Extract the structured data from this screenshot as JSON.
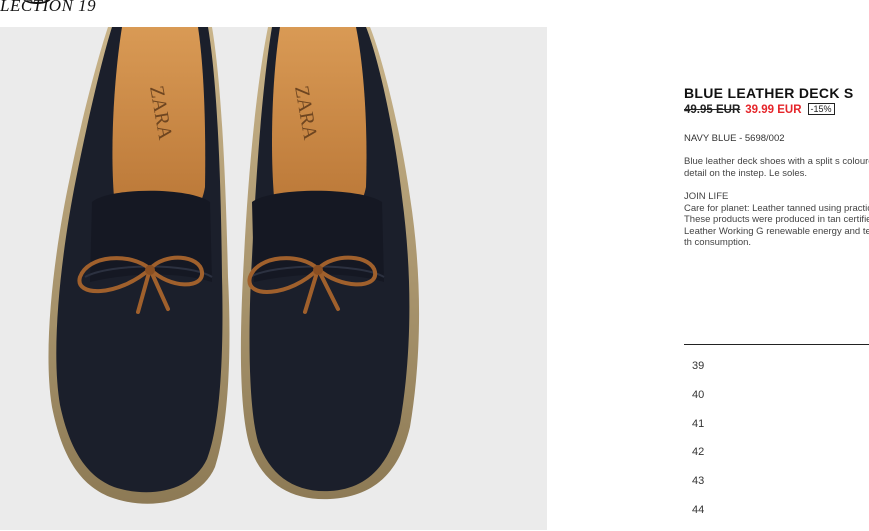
{
  "header": {
    "collection_label": "LECTION 19"
  },
  "product": {
    "title": "BLUE LEATHER DECK S",
    "price_old": "49.95 EUR",
    "price_new": "39.99 EUR",
    "discount": "-15%",
    "color_ref": "NAVY BLUE - 5698/002",
    "description": "Blue leather deck shoes with a split s coloured bow detail on the instep. Le soles.",
    "join_life": {
      "heading": "JOIN LIFE",
      "care_text": "Care for planet: Leather tanned using practices.",
      "production_text": "These products were produced in tan certified under the Leather Working G renewable energy and technologies th consumption."
    }
  },
  "image": {
    "brand_mark": "ZARA"
  },
  "sizes": [
    "39",
    "40",
    "41",
    "42",
    "43",
    "44"
  ],
  "colors": {
    "price_sale": "#e5252a",
    "image_bg": "#ebebeb",
    "shoe_navy": "#1b1f2b",
    "lace_brown": "#a0602c"
  }
}
